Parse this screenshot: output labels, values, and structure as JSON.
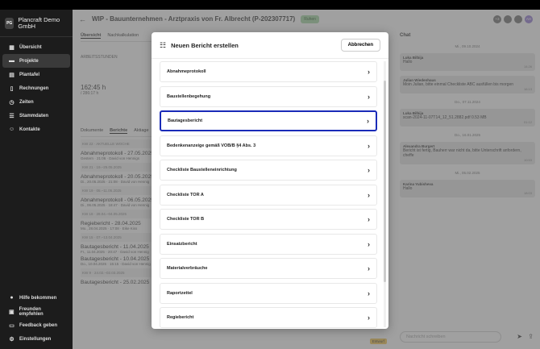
{
  "app": {
    "logo": "PG",
    "name": "Plancraft Demo GmbH"
  },
  "sidebar": {
    "items": [
      {
        "label": "Übersicht",
        "icon": "grid-icon"
      },
      {
        "label": "Projekte",
        "icon": "folder-icon"
      },
      {
        "label": "Plantafel",
        "icon": "calendar-icon"
      },
      {
        "label": "Rechnungen",
        "icon": "invoice-icon"
      },
      {
        "label": "Zeiten",
        "icon": "clock-icon"
      },
      {
        "label": "Stammdaten",
        "icon": "database-icon"
      },
      {
        "label": "Kontakte",
        "icon": "contacts-icon"
      }
    ],
    "bottom": [
      {
        "label": "Hilfe bekommen",
        "icon": "help-icon"
      },
      {
        "label": "Freunden empfehlen",
        "icon": "gift-icon"
      },
      {
        "label": "Feedback geben",
        "icon": "feedback-icon"
      },
      {
        "label": "Einstellungen",
        "icon": "gear-icon"
      }
    ]
  },
  "header": {
    "title": "WIP - Bauunternehmen - Arztpraxis von Fr. Albrecht (P-202307717)",
    "status": "Ruhen",
    "avatars": [
      "+3",
      "",
      "",
      "AH"
    ]
  },
  "content": {
    "tabs": [
      "Übersicht",
      "Nachkalkulation"
    ],
    "worktime_label": "ARBEITSSTUNDEN",
    "hours": "162:45 h",
    "hours_sub": "/ 286:17 h",
    "doc_tabs": [
      "Dokumente",
      "Berichte",
      "Aktiage"
    ],
    "reports": [
      {
        "week": "KW 22 · AKTUELLE WOCHE",
        "title": "Abnahmeprotokoll - 27.05.2025",
        "sub": "Gestern · 21:06 · David von Hennigs"
      },
      {
        "week": "KW 21 · 19.–25.05.2025",
        "title": "Abnahmeprotokoll - 20.05.2025",
        "sub": "Di., 20.05.2025 · 21:08 · David von Hennig"
      },
      {
        "week": "KW 19 · 05.–11.05.2025",
        "title": "Abnahmeprotokoll - 06.05.2025",
        "sub": "Di., 06.05.2025 · 18:47 · David von Hennig"
      },
      {
        "week": "KW 18 · 28.04.–04.05.2025",
        "title": "Regiebericht - 28.04.2025",
        "sub": "Mo., 28.04.2025 · 17:08 · Eike Kiss"
      },
      {
        "week": "KW 15 · 07.–13.04.2025",
        "title": "Bautagesbericht - 11.04.2025",
        "sub": "Fr., 11.04.2025 · 20:47 · David von Hennig"
      },
      {
        "week": "",
        "title": "Bautagesbericht - 10.04.2025",
        "sub": "Do., 10.04.2025 · 15:15 · David von Hennig"
      },
      {
        "week": "KW 9 · 24.02.–02.03.2025",
        "title": "Bautagesbericht - 25.02.2025",
        "sub": ""
      }
    ],
    "draft_badge": "Entwurf"
  },
  "chat": {
    "title": "Chat",
    "messages": [
      {
        "date": "Mi., 09.10.2024",
        "name": "Luka Bilbija",
        "text": "Hallo",
        "time": "14:26"
      },
      {
        "date": "",
        "name": "Julian Wiedenhaus",
        "text": "Moin Julian, bitte einmal Checkliste ABC ausfüllen bis morgen",
        "time": "16:13"
      },
      {
        "date": "Do., 07.11.2024",
        "name": "Luka Bilbija",
        "text": "scan-2024-11-07T14_12_51.2882.pdf 0.53 MB",
        "time": "01:12"
      },
      {
        "date": "Do., 16.01.2025",
        "name": "Alexandra Burgert",
        "text": "Bericht ist fertig, Bauherr war nicht da, bitte Unterschrift anfordern, cheffe",
        "time": "10:53"
      },
      {
        "date": "Mi., 05.02.2025",
        "name": "Karina Yubisheva",
        "text": "Hallo",
        "time": "18:03"
      }
    ],
    "input_placeholder": "Nachricht schreiben"
  },
  "modal": {
    "title": "Neuen Bericht erstellen",
    "cancel": "Abbrechen",
    "items": [
      {
        "label": "Abnahmeprotokoll"
      },
      {
        "label": "Baustellenbegehung"
      },
      {
        "label": "Bautagesbericht",
        "selected": true
      },
      {
        "label": "Bedenkenanzeige gemäß VOB/B §4 Abs. 3"
      },
      {
        "label": "Checkliste Baustelleneinrichtung"
      },
      {
        "label": "Checkliste TOR A"
      },
      {
        "label": "Checkliste TOR B"
      },
      {
        "label": "Einsatzbericht"
      },
      {
        "label": "Materialverbräuche"
      },
      {
        "label": "Raportzettel"
      },
      {
        "label": "Regiebericht"
      }
    ]
  },
  "colors": {
    "accent": "#1a2bb8",
    "sidebar": "#1c1c1c"
  }
}
